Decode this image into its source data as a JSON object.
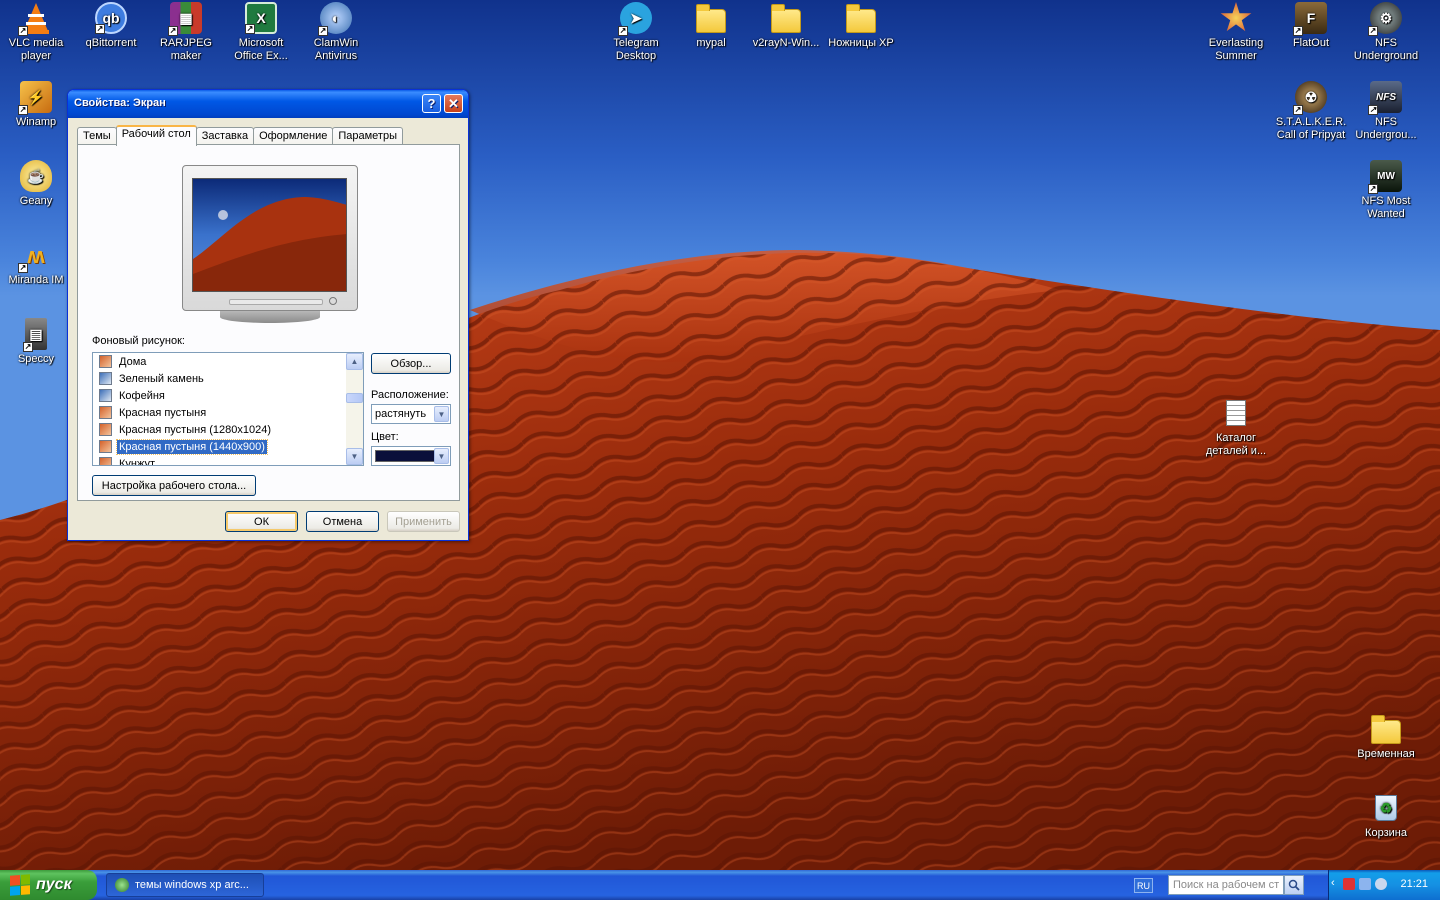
{
  "desktop": {
    "icons_left": [
      {
        "label": "VLC media player",
        "icon": "vlc-icon",
        "color": "#f47d13"
      },
      {
        "label": "qBittorrent",
        "icon": "qbittorrent-icon",
        "color": "#3d7ce0"
      },
      {
        "label": "RARJPEG maker",
        "icon": "rarjpeg-icon",
        "color": "#8b2f8f"
      },
      {
        "label": "Microsoft Office Ex...",
        "icon": "excel-icon",
        "color": "#1f7a3f"
      },
      {
        "label": "ClamWin Antivirus",
        "icon": "clamwin-icon",
        "color": "#3a6fb0"
      },
      {
        "label": "Winamp",
        "icon": "winamp-icon",
        "color": "#f0a020"
      },
      {
        "label": "Geany",
        "icon": "geany-icon",
        "color": "#e0b030"
      },
      {
        "label": "Miranda IM",
        "icon": "miranda-icon",
        "color": "#e0a020"
      },
      {
        "label": "Speccy",
        "icon": "speccy-icon",
        "color": "#555555"
      }
    ],
    "icons_top": [
      {
        "label": "Telegram Desktop",
        "icon": "telegram-icon",
        "color": "#2aa3df"
      },
      {
        "label": "mypal",
        "icon": "folder-icon"
      },
      {
        "label": "v2rayN-Win...",
        "icon": "folder-icon"
      },
      {
        "label": "Ножницы XP",
        "icon": "folder-icon"
      }
    ],
    "icons_right": [
      {
        "label": "Everlasting Summer",
        "icon": "everlasting-summer-icon",
        "color": "#d33a2a"
      },
      {
        "label": "FlatOut",
        "icon": "flatout-icon",
        "color": "#6b4a22"
      },
      {
        "label": "NFS Underground",
        "icon": "nfs-underground-icon",
        "color": "#2a2a2a"
      },
      {
        "label": "S.T.A.L.K.E.R. Call of Pripyat",
        "icon": "stalker-icon",
        "color": "#4a3a2a"
      },
      {
        "label": "NFS Undergrou...",
        "icon": "nfs-underground2-icon",
        "color": "#333a48"
      },
      {
        "label": "NFS Most Wanted",
        "icon": "nfs-most-wanted-icon",
        "color": "#223322"
      }
    ],
    "icon_catalog": {
      "label": "Каталог деталей и...",
      "icon": "document-icon"
    },
    "icon_temp": {
      "label": "Временная",
      "icon": "folder-icon"
    },
    "icon_recycle": {
      "label": "Корзина",
      "icon": "recycle-bin-icon"
    }
  },
  "dialog": {
    "title": "Свойства: Экран",
    "tabs": [
      "Темы",
      "Рабочий стол",
      "Заставка",
      "Оформление",
      "Параметры"
    ],
    "active_tab": 1,
    "background_label": "Фоновый рисунок:",
    "backgrounds": [
      {
        "name": "Дома",
        "icon": "image-file-icon"
      },
      {
        "name": "Зеленый камень",
        "icon": "image-file-icon"
      },
      {
        "name": "Кофейня",
        "icon": "image-file-icon"
      },
      {
        "name": "Красная пустыня",
        "icon": "image-file-icon"
      },
      {
        "name": "Красная пустыня  (1280x1024)",
        "icon": "image-file-icon"
      },
      {
        "name": "Красная пустыня (1440x900)",
        "icon": "image-file-icon",
        "selected": true
      },
      {
        "name": "Кунжут",
        "icon": "image-file-icon"
      }
    ],
    "browse_label": "Обзор...",
    "position_label": "Расположение:",
    "position_value": "растянуть",
    "color_label": "Цвет:",
    "color_value": "#0a0f3a",
    "customize_label": "Настройка рабочего стола...",
    "ok_label": "ОК",
    "cancel_label": "Отмена",
    "apply_label": "Применить"
  },
  "taskbar": {
    "start_label": "пуск",
    "tasks": [
      {
        "label": "темы windows xp arc...",
        "icon": "browser-icon"
      }
    ],
    "language": "RU",
    "search_placeholder": "Поиск на рабочем ст",
    "clock": "21:21"
  }
}
